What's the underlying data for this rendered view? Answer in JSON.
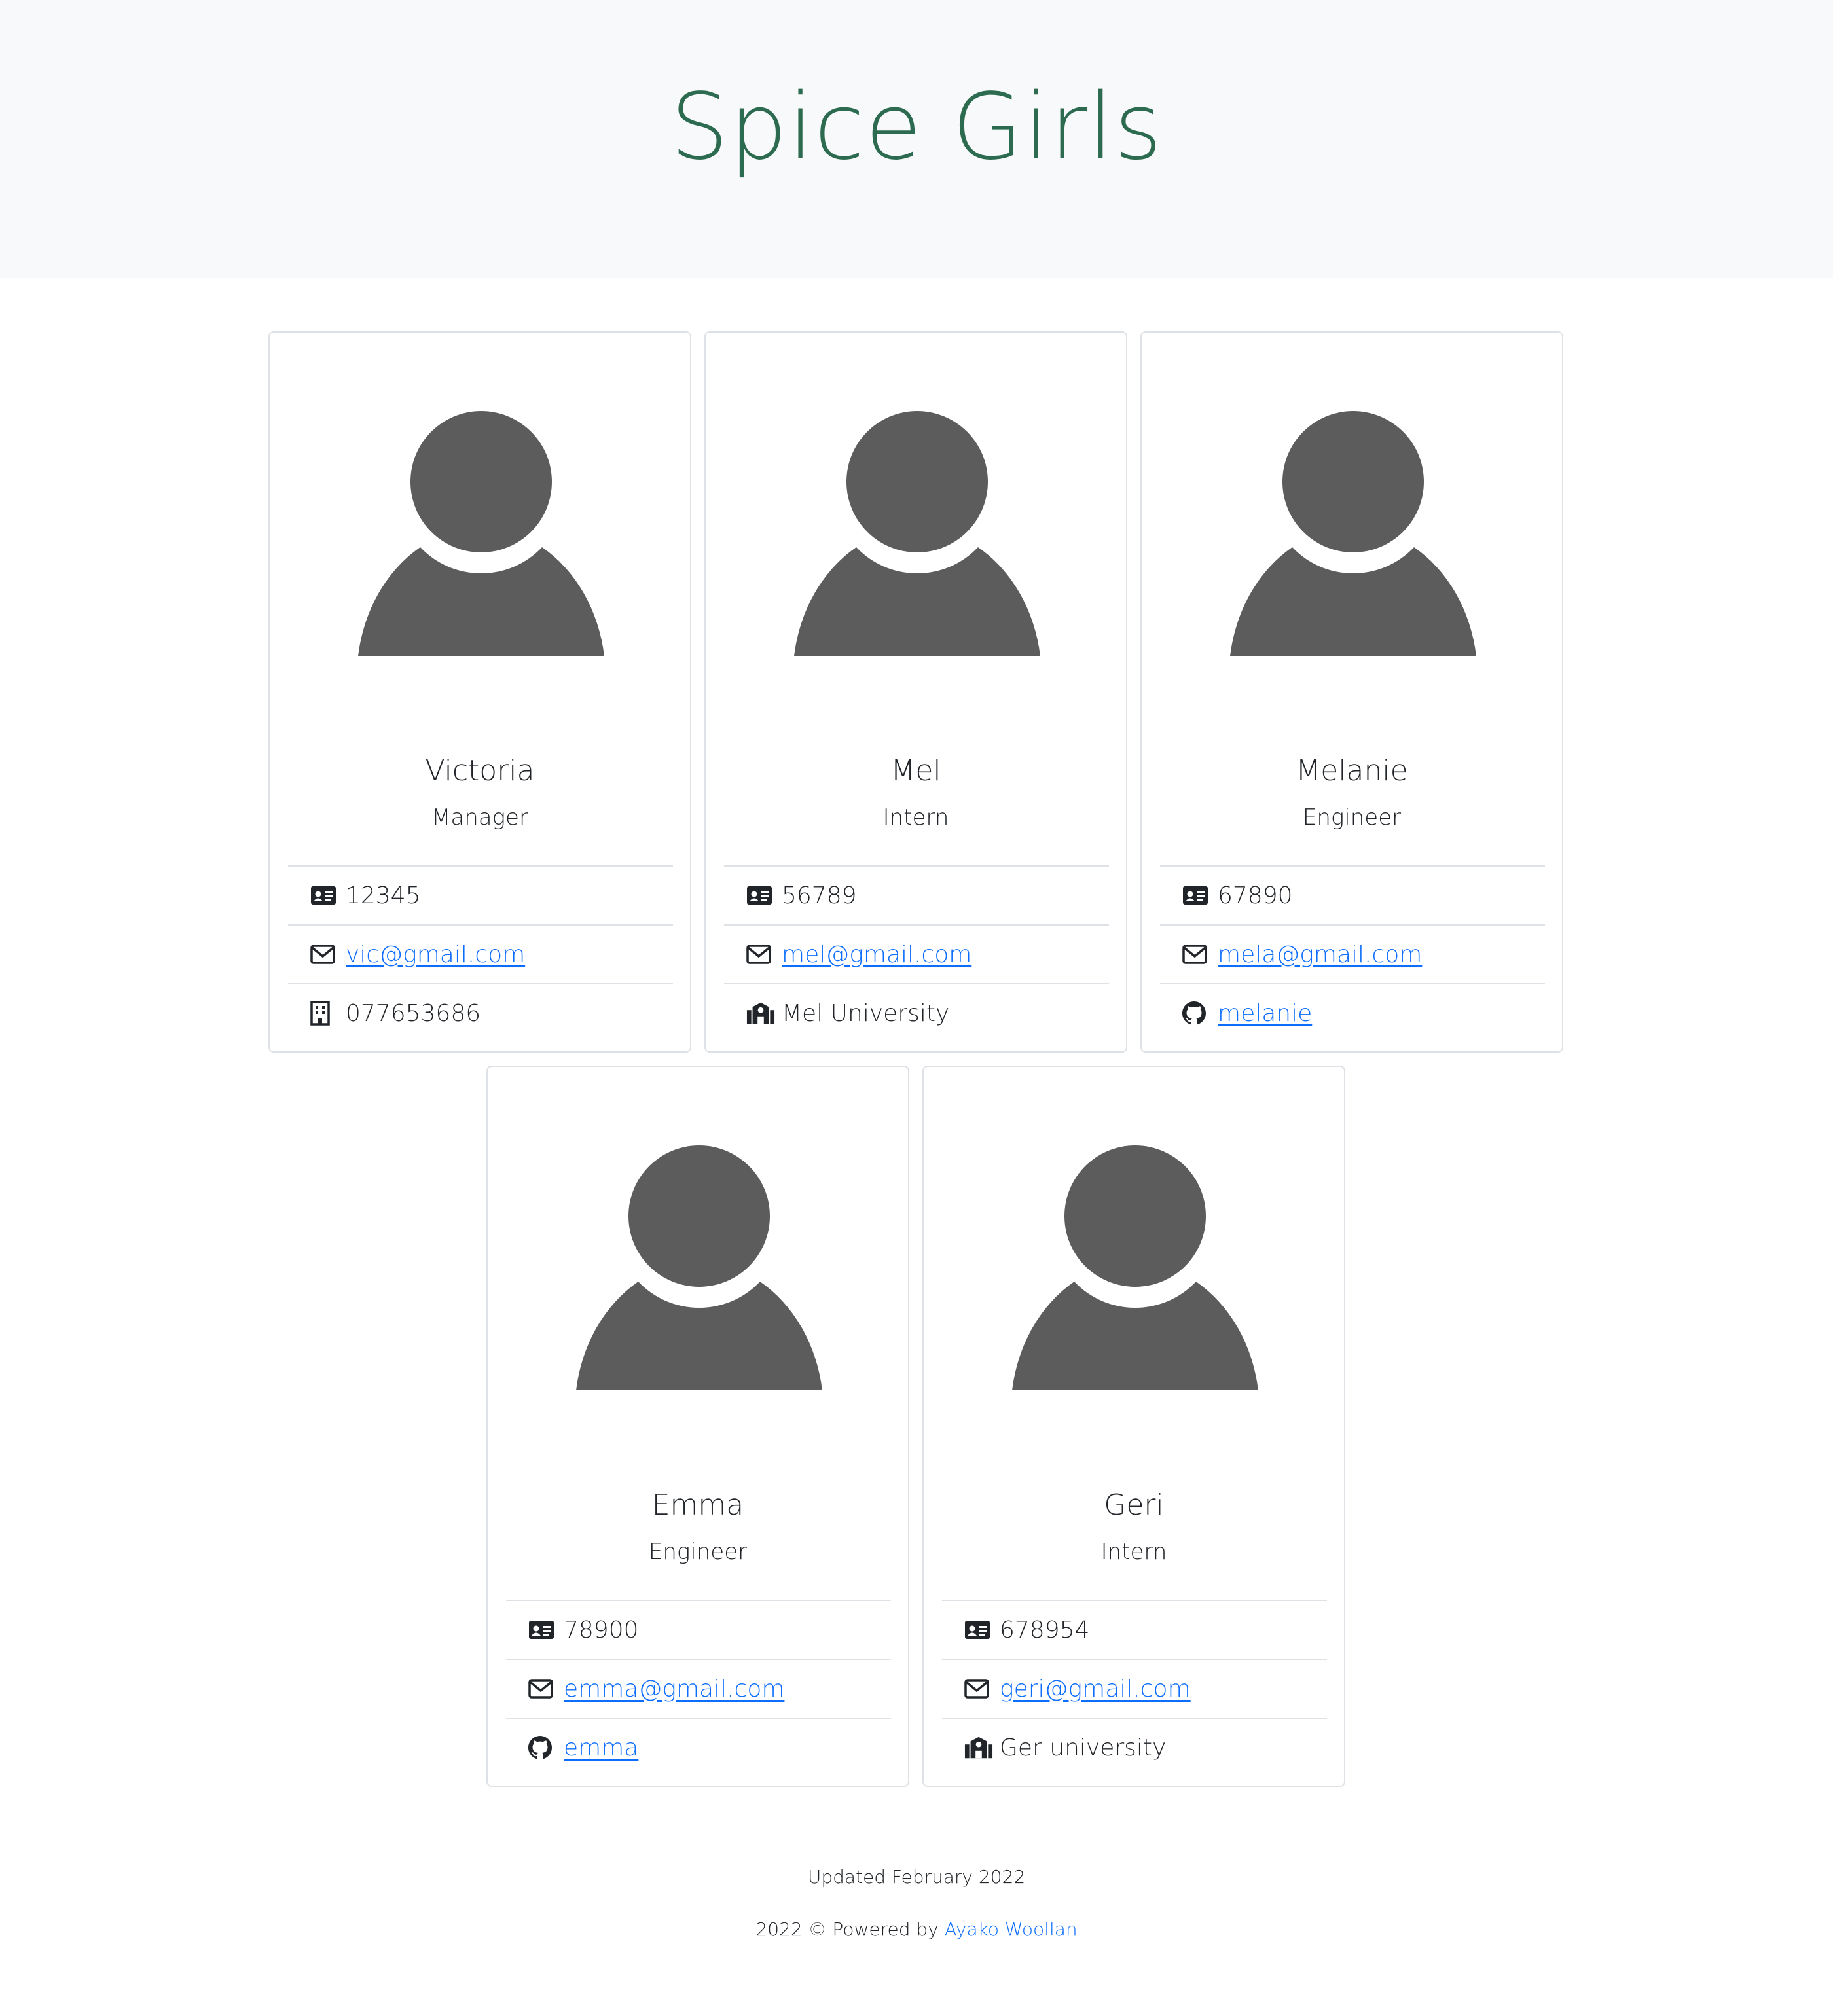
{
  "header": {
    "title": "Spice Girls"
  },
  "team": [
    {
      "name": "Victoria",
      "role": "Manager",
      "id": "12345",
      "email": "vic@gmail.com",
      "extra": "077653686",
      "extra_type": "office"
    },
    {
      "name": "Mel",
      "role": "Intern",
      "id": "56789",
      "email": "mel@gmail.com",
      "extra": "Mel University",
      "extra_type": "school"
    },
    {
      "name": "Melanie",
      "role": "Engineer",
      "id": "67890",
      "email": "mela@gmail.com",
      "extra": "melanie",
      "extra_type": "github"
    },
    {
      "name": "Emma",
      "role": "Engineer",
      "id": "78900",
      "email": "emma@gmail.com",
      "extra": "emma",
      "extra_type": "github"
    },
    {
      "name": "Geri",
      "role": "Intern",
      "id": "678954",
      "email": "geri@gmail.com",
      "extra": "Ger university",
      "extra_type": "school"
    }
  ],
  "footer": {
    "updated": "Updated February 2022",
    "credit_prefix": "2022 © Powered by ",
    "credit_link": "Ayako Woollan"
  },
  "colors": {
    "title": "#2c6b4f",
    "hero_bg": "#f8f9fa",
    "link": "#0d6efd",
    "avatar": "#5b5c5b"
  },
  "icons": {
    "id": "id-card-icon",
    "email": "envelope-icon",
    "office": "building-icon",
    "school": "school-icon",
    "github": "github-icon"
  }
}
